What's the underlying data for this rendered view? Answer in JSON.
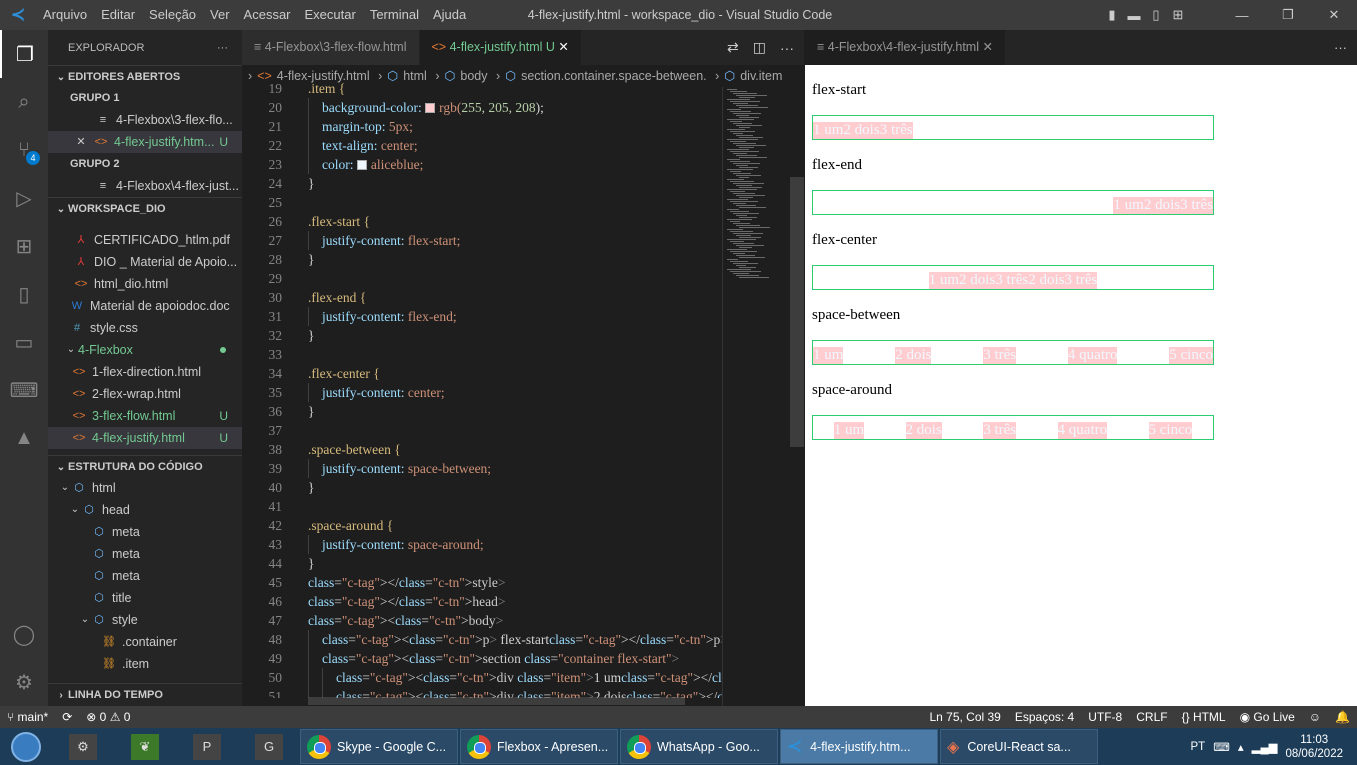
{
  "titlebar": {
    "menu": [
      "Arquivo",
      "Editar",
      "Seleção",
      "Ver",
      "Acessar",
      "Executar",
      "Terminal",
      "Ajuda"
    ],
    "title": "4-flex-justify.html - workspace_dio - Visual Studio Code"
  },
  "activity": {
    "badge": "4"
  },
  "sidebar": {
    "header": "EXPLORADOR",
    "open_editors": "EDITORES ABERTOS",
    "group1": "GRUPO 1",
    "group1_items": [
      "4-Flexbox\\3-flex-flo...",
      "4-flex-justify.htm..."
    ],
    "group2": "GRUPO 2",
    "group2_items": [
      "4-Flexbox\\4-flex-just..."
    ],
    "workspace": "WORKSPACE_DIO",
    "files": [
      "CERTIFICADO_htlm.pdf",
      "DIO _ Material de Apoio...",
      "html_dio.html",
      "Material de apoiodoc.doc",
      "style.css"
    ],
    "folder": "4-Flexbox",
    "folder_files": [
      "1-flex-direction.html",
      "2-flex-wrap.html",
      "3-flex-flow.html",
      "4-flex-justify.html"
    ],
    "outline": "ESTRUTURA DO CÓDIGO",
    "outline_items": [
      "html",
      "head",
      "meta",
      "meta",
      "meta",
      "title",
      "style",
      ".container",
      ".item"
    ],
    "timeline": "LINHA DO TEMPO",
    "u_mark": "U"
  },
  "editor": {
    "tabs": [
      "4-Flexbox\\3-flex-flow.html",
      "4-flex-justify.html"
    ],
    "tab_u": "U",
    "breadcrumb": [
      "4-flex-justify.html",
      "html",
      "body",
      "section.container.space-between.",
      "div.item"
    ],
    "lines": [
      {
        "n": "19",
        "t": ".item {"
      },
      {
        "n": "20",
        "t": "background-color:",
        "v": "rgb(255, 205, 208);"
      },
      {
        "n": "21",
        "t": "margin-top:",
        "v": "5px;"
      },
      {
        "n": "22",
        "t": "text-align:",
        "v": "center;"
      },
      {
        "n": "23",
        "t": "color:",
        "v": "aliceblue;"
      },
      {
        "n": "24",
        "t": "}"
      },
      {
        "n": "25",
        "t": ""
      },
      {
        "n": "26",
        "t": ".flex-start {"
      },
      {
        "n": "27",
        "t": "justify-content:",
        "v": "flex-start;"
      },
      {
        "n": "28",
        "t": "}"
      },
      {
        "n": "29",
        "t": ""
      },
      {
        "n": "30",
        "t": ".flex-end {"
      },
      {
        "n": "31",
        "t": "justify-content:",
        "v": "flex-end;"
      },
      {
        "n": "32",
        "t": "}"
      },
      {
        "n": "33",
        "t": ""
      },
      {
        "n": "34",
        "t": ".flex-center {"
      },
      {
        "n": "35",
        "t": "justify-content:",
        "v": "center;"
      },
      {
        "n": "36",
        "t": "}"
      },
      {
        "n": "37",
        "t": ""
      },
      {
        "n": "38",
        "t": ".space-between {"
      },
      {
        "n": "39",
        "t": "justify-content:",
        "v": "space-between;"
      },
      {
        "n": "40",
        "t": "}"
      },
      {
        "n": "41",
        "t": ""
      },
      {
        "n": "42",
        "t": ".space-around {"
      },
      {
        "n": "43",
        "t": "justify-content:",
        "v": "space-around;"
      },
      {
        "n": "44",
        "t": "}"
      },
      {
        "n": "45",
        "t": "</style>"
      },
      {
        "n": "46",
        "t": "</head>"
      },
      {
        "n": "47",
        "t": "<body>"
      },
      {
        "n": "48",
        "t": "<p> flex-start</p>"
      },
      {
        "n": "49",
        "t": "<section class=\"container flex-start\">"
      },
      {
        "n": "50",
        "t": "<div class=\"item\">1 um</div>"
      },
      {
        "n": "51",
        "t": "<div class=\"item\">2 dois</div>"
      }
    ]
  },
  "preview": {
    "tab": "4-Flexbox\\4-flex-justify.html",
    "sections": [
      {
        "label": "flex-start",
        "items": [
          "1 um",
          "2 dois",
          "3 três"
        ]
      },
      {
        "label": "flex-end",
        "items": [
          "1 um",
          "2 dois",
          "3 três"
        ]
      },
      {
        "label": "flex-center",
        "items": [
          "1 um",
          "2 dois",
          "3 três",
          "2 dois",
          "3 três"
        ]
      },
      {
        "label": "space-between",
        "items": [
          "1 um",
          "2 dois",
          "3 três",
          "4 quatro",
          "5 cinco"
        ]
      },
      {
        "label": "space-around",
        "items": [
          "1 um",
          "2 dois",
          "3 três",
          "4 quatro",
          "5 cinco"
        ]
      }
    ]
  },
  "statusbar": {
    "branch": "main*",
    "problems": "⊗ 0 ⚠ 0",
    "position": "Ln 75, Col 39",
    "spaces": "Espaços: 4",
    "encoding": "UTF-8",
    "eol": "CRLF",
    "language": "HTML",
    "golive": "Go Live"
  },
  "taskbar": {
    "pins": [
      "P",
      "G"
    ],
    "buttons": [
      "Skype - Google C...",
      "Flexbox - Apresen...",
      "WhatsApp - Goo...",
      "4-flex-justify.htm...",
      "CoreUI-React sa..."
    ],
    "lang": "PT",
    "time": "11:03",
    "date": "08/06/2022"
  }
}
